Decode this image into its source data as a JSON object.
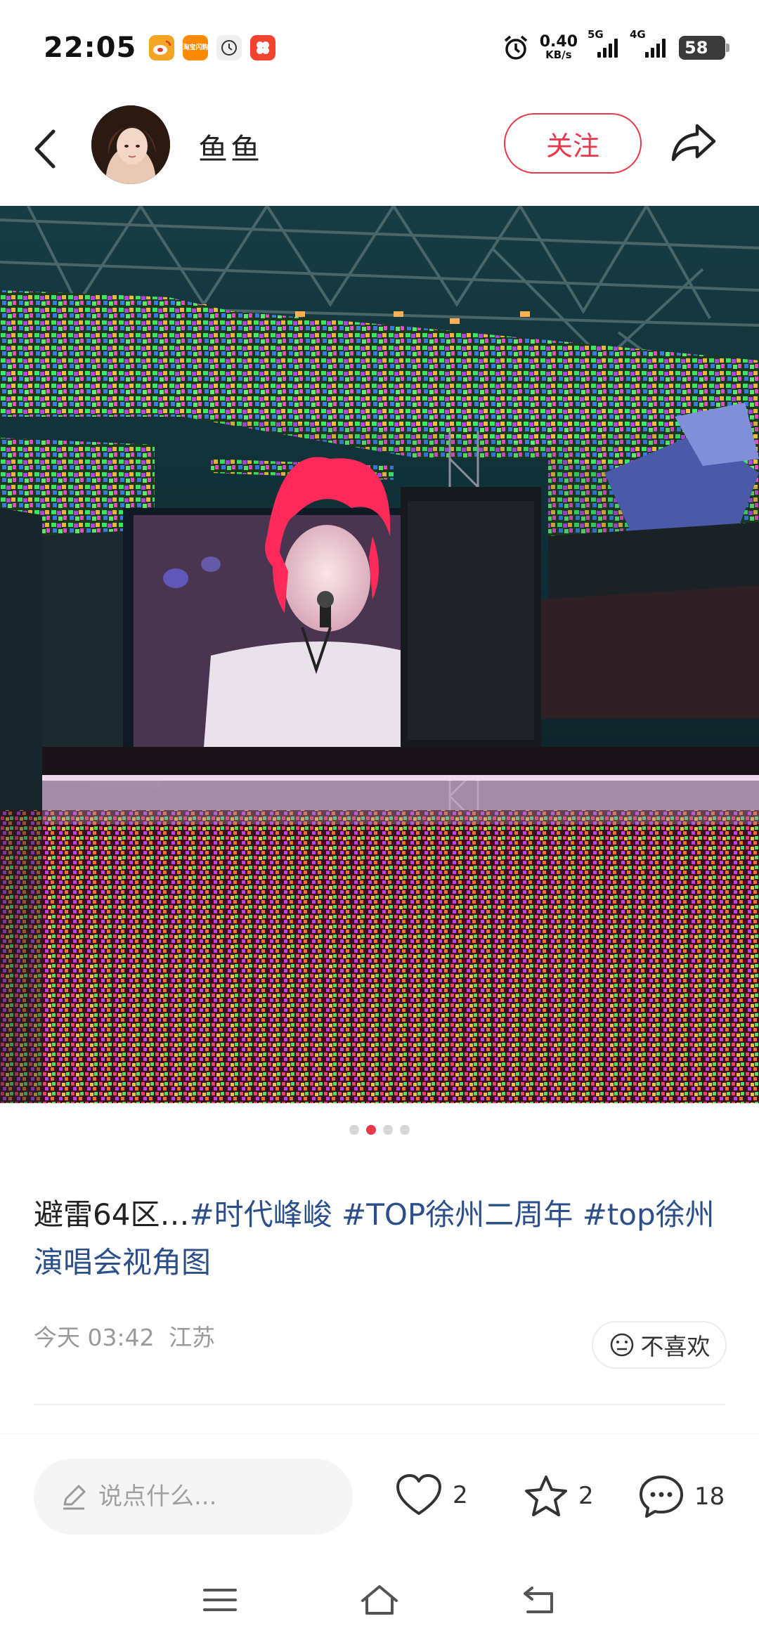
{
  "status_bar": {
    "time": "22:05",
    "net_speed_value": "0.40",
    "net_speed_unit": "KB/s",
    "signal_1_label": "5G",
    "signal_2_label": "4G",
    "battery": "58",
    "apps": [
      {
        "icon": "weibo-icon",
        "color": "#f4a524"
      },
      {
        "icon": "taobao-shop-icon",
        "color": "#ff8a00",
        "text": "淘宝闪购"
      },
      {
        "icon": "clock-icon",
        "color": "#e9e9e9"
      },
      {
        "icon": "app-red-icon",
        "color": "#f2432f"
      }
    ]
  },
  "header": {
    "back_icon": "chevron-left-icon",
    "username": "鱼鱼",
    "follow_label": "关注",
    "share_icon": "share-arrow-icon"
  },
  "carousel": {
    "total": 4,
    "active": 2
  },
  "post": {
    "caption_prefix": "避雷64区…",
    "tags": [
      "#时代峰峻",
      "#TOP徐州二周年",
      "#top徐州演唱会视角图"
    ],
    "time": "今天 03:42",
    "location": "江苏",
    "dislike_label": "不喜欢"
  },
  "actions": {
    "comment_placeholder": "说点什么...",
    "likes": "2",
    "stars": "2",
    "comments": "18"
  },
  "colors": {
    "accent": "#e8384a",
    "tag": "#2b4f8a"
  }
}
